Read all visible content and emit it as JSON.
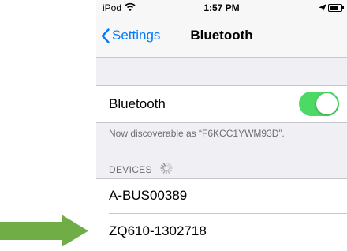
{
  "status_bar": {
    "carrier": "iPod",
    "time": "1:57 PM",
    "wifi_icon": "wifi-icon",
    "location_icon": "location-arrow-icon",
    "battery_icon": "battery-icon",
    "battery_level": 0.85
  },
  "nav": {
    "back_label": "Settings",
    "title": "Bluetooth"
  },
  "bluetooth_toggle": {
    "label": "Bluetooth",
    "on": true
  },
  "discoverable_note": "Now discoverable as “F6KCC1YWM93D”.",
  "devices": {
    "header": "DEVICES",
    "items": [
      "A-BUS00389",
      "ZQ610-1302718"
    ]
  },
  "colors": {
    "accent": "#007aff",
    "toggle_on": "#4cd964",
    "arrow": "#70ad47"
  }
}
